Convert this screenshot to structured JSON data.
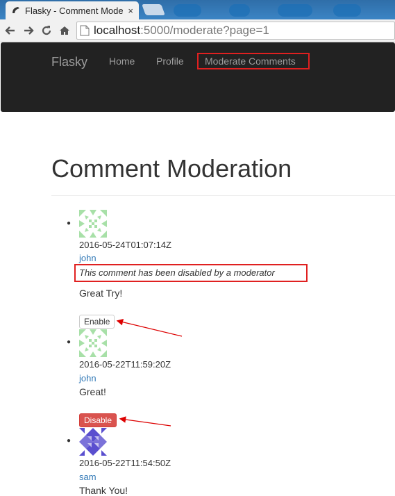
{
  "browser": {
    "tab_title": "Flasky - Comment Mode",
    "tab_close": "×",
    "url_host": "localhost",
    "url_path": ":5000/moderate?page=1"
  },
  "navbar": {
    "brand": "Flasky",
    "links": [
      "Home",
      "Profile",
      "Moderate Comments"
    ]
  },
  "page": {
    "title": "Comment Moderation"
  },
  "comments": [
    {
      "timestamp": "2016-05-24T01:07:14Z",
      "author": "john",
      "notice": "This comment has been disabled by a moderator",
      "body": "Great Try!",
      "button": "Enable",
      "avatar_color": "#a8e0a8"
    },
    {
      "timestamp": "2016-05-22T11:59:20Z",
      "author": "john",
      "body": "Great!",
      "button": "Disable",
      "avatar_color": "#a8e0a8"
    },
    {
      "timestamp": "2016-05-22T11:54:50Z",
      "author": "sam",
      "body": "Thank You!",
      "avatar_color": "#5a4fcf"
    }
  ],
  "colors": {
    "highlight": "#e02020",
    "navbar": "#222222",
    "link": "#337ab7",
    "danger": "#d9534f"
  }
}
